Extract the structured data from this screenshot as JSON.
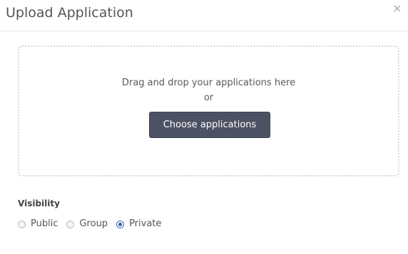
{
  "dialog": {
    "title": "Upload Application",
    "close_label": "×"
  },
  "dropzone": {
    "instruction": "Drag and drop your applications here",
    "separator": "or",
    "choose_button_label": "Choose applications"
  },
  "visibility": {
    "label": "Visibility",
    "options": [
      {
        "label": "Public",
        "checked": false
      },
      {
        "label": "Group",
        "checked": false
      },
      {
        "label": "Private",
        "checked": true
      }
    ]
  },
  "colors": {
    "button_bg": "#4c5263",
    "radio_selected": "#3b5ea8",
    "dropzone_border": "#d7d7d7"
  },
  "icons": {
    "close": "close-icon"
  }
}
